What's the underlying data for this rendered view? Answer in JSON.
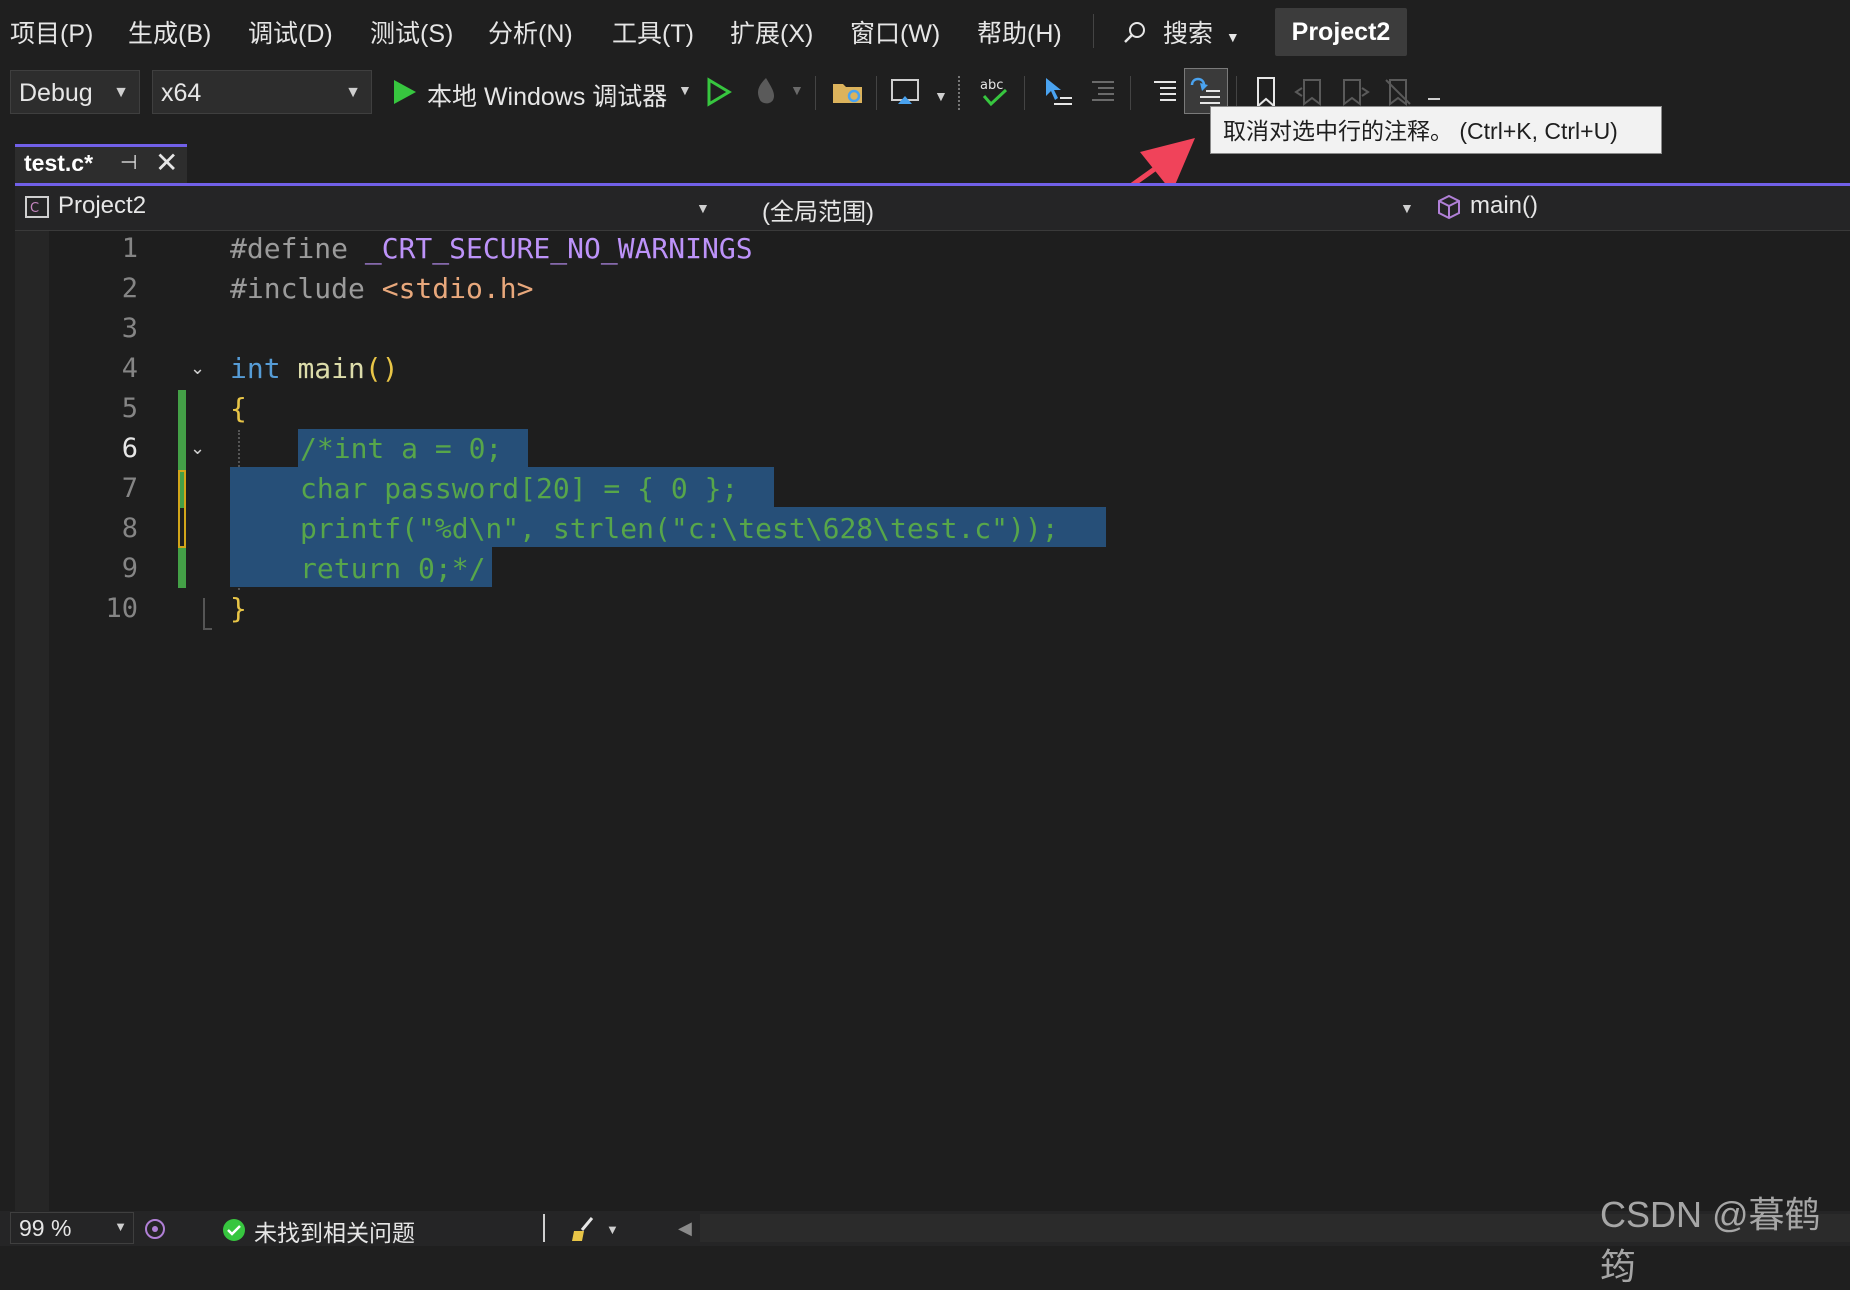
{
  "menu": {
    "items": [
      "项目(P)",
      "生成(B)",
      "调试(D)",
      "测试(S)",
      "分析(N)",
      "工具(T)",
      "扩展(X)",
      "窗口(W)",
      "帮助(H)"
    ],
    "search_label": "搜索",
    "project_name": "Project2"
  },
  "toolbar": {
    "configuration": "Debug",
    "platform": "x64",
    "run_target": "本地 Windows 调试器"
  },
  "tooltip": {
    "text": "取消对选中行的注释。 (Ctrl+K, Ctrl+U)"
  },
  "tab": {
    "file_name": "test.c*"
  },
  "navbar": {
    "project": "Project2",
    "scope": "(全局范围)",
    "member": "main()"
  },
  "editor": {
    "line_numbers": [
      "1",
      "2",
      "3",
      "4",
      "5",
      "6",
      "7",
      "8",
      "9",
      "10"
    ],
    "active_line": 6,
    "lines": [
      "#define _CRT_SECURE_NO_WARNINGS",
      "#include <stdio.h>",
      "",
      "int main()",
      "{",
      "/*int a = 0;",
      "char password[20] = { 0 };",
      "printf(\"%d\\n\", strlen(\"c:\\test\\628\\test.c\"));",
      "return 0;*/",
      "}"
    ]
  },
  "statusbar": {
    "zoom": "99 %",
    "issues": "未找到相关问题"
  },
  "watermark": "CSDN @暮鹤筠",
  "colors": {
    "accent": "#7160e8",
    "selection": "#264f78",
    "comment": "#57a64a",
    "keyword": "#569cd6",
    "string": "#d69d85",
    "tooltip_arrow": "#f0435a"
  }
}
